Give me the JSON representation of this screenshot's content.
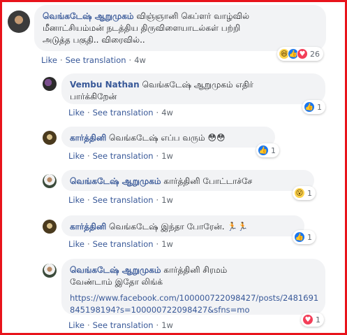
{
  "comments": [
    {
      "author": "வெங்கடேஷ் ஆறுமுகம்",
      "text_line1": "விஞ்ஞானி கெப்ளர் வாழ்வில்",
      "text_line2": "மீனாட்சியம்மன் நடத்திய திருவிளையாடல்கள் பற்றி",
      "text_line3": "அடுத்த பகுதி.. விரைவில்..",
      "like": "Like",
      "translate": "See translation",
      "time": "4w",
      "reaction_count": "26",
      "reactions": [
        "haha-icon",
        "like-icon",
        "love-icon"
      ]
    }
  ],
  "replies": [
    {
      "author": "Vembu Nathan",
      "text_line1": "வெங்கடேஷ் ஆறுமுகம் எதிர்",
      "text_line2": "பார்க்கிறேன்",
      "like": "Like",
      "translate": "See translation",
      "time": "4w",
      "reaction_count": "1"
    },
    {
      "author": "கார்த்தினி",
      "text_line1": "வெங்கடேஷ் எப்ப வரும் 😳😳",
      "like": "Like",
      "translate": "See translation",
      "time": "1w",
      "reaction_count": "1"
    },
    {
      "author": "வெங்கடேஷ் ஆறுமுகம்",
      "text_line1": "கார்த்தினி போட்டாச்சே",
      "like": "Like",
      "translate": "See translation",
      "time": "1w",
      "reaction_count": "1"
    },
    {
      "author": "கார்த்தினி",
      "text_line1": "வெங்கடேஷ் இந்தா போரேன். 🏃🏃",
      "like": "Like",
      "translate": "See translation",
      "time": "1w",
      "reaction_count": "1"
    },
    {
      "author": "வெங்கடேஷ் ஆறுமுகம்",
      "text_line1": "கார்த்தினி சிரமம்",
      "text_line2": "வேண்டாம் இதோ லிங்க்",
      "link_line1": "https://www.facebook.com/100000722098427/posts/2481691",
      "link_line2": "845198194?s=100000722098427&sfns=mo",
      "like": "Like",
      "translate": "See translation",
      "time": "1w",
      "reaction_count": "1"
    }
  ],
  "colors": {
    "frame_border": "#e8131b",
    "bubble": "#f2f3f5",
    "author": "#385898",
    "meta": "#606770"
  }
}
